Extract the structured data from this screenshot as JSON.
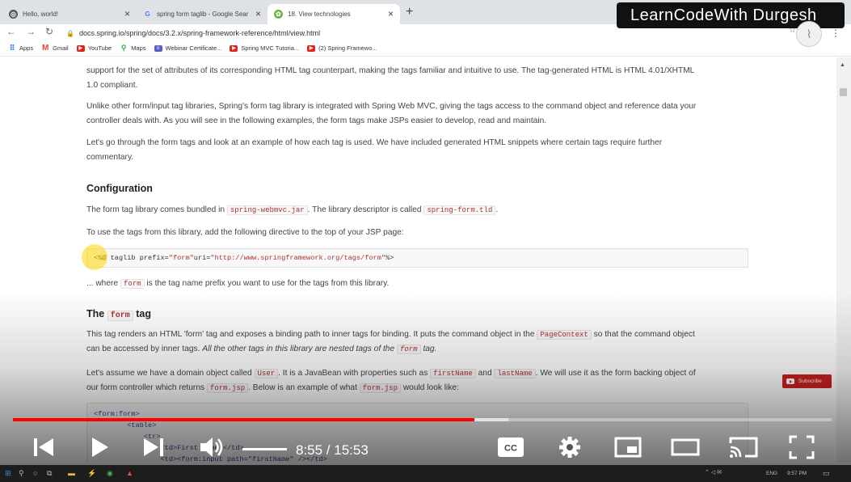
{
  "browser": {
    "tabs": [
      {
        "title": "Hello, world!",
        "active": false
      },
      {
        "title": "spring form taglib - Google Sear",
        "active": false
      },
      {
        "title": "18. View technologies",
        "active": true
      }
    ],
    "url_domain": "docs.spring.io",
    "url_path": "/spring/docs/3.2.x/spring-framework-reference/html/view.html",
    "bookmarks": [
      "Apps",
      "Gmail",
      "YouTube",
      "Maps",
      "Webinar Certificate...",
      "Spring MVC Tutoria...",
      "(2) Spring Framewo..."
    ],
    "watermark": "LearnCodeWith Durgesh"
  },
  "doc": {
    "intro_line1": "support for the set of attributes of its corresponding HTML tag counterpart, making the tags familiar and intuitive to use. The tag-generated HTML is HTML 4.01/XHTML",
    "intro_line2": "1.0 compliant.",
    "unlike_line1": "Unlike other form/input tag libraries, Spring's form tag library is integrated with Spring Web MVC, giving the tags access to the command object and reference data your",
    "unlike_line2": "controller deals with. As you will see in the following examples, the form tags make JSPs easier to develop, read and maintain.",
    "letsgo_line1": "Let's go through the form tags and look at an example of how each tag is used. We have included generated HTML snippets where certain tags require further",
    "letsgo_line2": "commentary.",
    "config_heading": "Configuration",
    "config_p_a": "The form tag library comes bundled in",
    "config_code1": "spring-webmvc.jar",
    "config_p_b": ". The library descriptor is called",
    "config_code2": "spring-form.tld",
    "config_p_c": ".",
    "use_tags": "To use the tags from this library, add the following directive to the top of your JSP page:",
    "directive_open": "<%@ taglib prefix=",
    "directive_prefix": "\"form\"",
    "directive_uri_attr": " uri=",
    "directive_uri": "\"http://www.springframework.org/tags/form\"",
    "directive_close": " %>",
    "where_a": "... where",
    "where_code": "form",
    "where_b": "is the tag name prefix you want to use for the tags from this library.",
    "form_heading_a": "The",
    "form_heading_code": "form",
    "form_heading_b": "tag",
    "renders_a": "This tag renders an HTML 'form' tag and exposes a binding path to inner tags for binding. It puts the command object in the",
    "renders_code": "PageContext",
    "renders_b": "so that the command object",
    "renders_line2_a": "can be accessed by inner tags.",
    "renders_line2_em": "All the other tags in this library are nested tags of the",
    "renders_line2_code": "form",
    "renders_line2_b": "tag.",
    "assume_a": "Let's assume we have a domain object called",
    "assume_code1": "User",
    "assume_b": ". It is a JavaBean with properties such as",
    "assume_code2": "firstName",
    "assume_c": "and",
    "assume_code3": "lastName",
    "assume_d": ". We will use it as the form backing object of",
    "assume2_a": "our form controller which returns",
    "assume2_code1": "form.jsp",
    "assume2_b": ". Below is an example of what",
    "assume2_code2": "form.jsp",
    "assume2_c": "would look like:",
    "example_code": "<form:form>\n        <table>\n            <tr>\n                <td>First Name:</td>\n                <td><form:input path=\"firstName\" /></td>"
  },
  "subscribe_label": "Subscribe",
  "player": {
    "time": "8:55 / 15:53",
    "progress_played": 0.564,
    "progress_buffered": 0.605,
    "cc": "CC"
  },
  "taskbar": {
    "lang": "ENG",
    "clock": "9:57 PM"
  },
  "colors": {
    "progress": "#ff0000",
    "watermark_bg": "#111111",
    "code_text": "#b03030",
    "subscribe": "#cc2020"
  }
}
